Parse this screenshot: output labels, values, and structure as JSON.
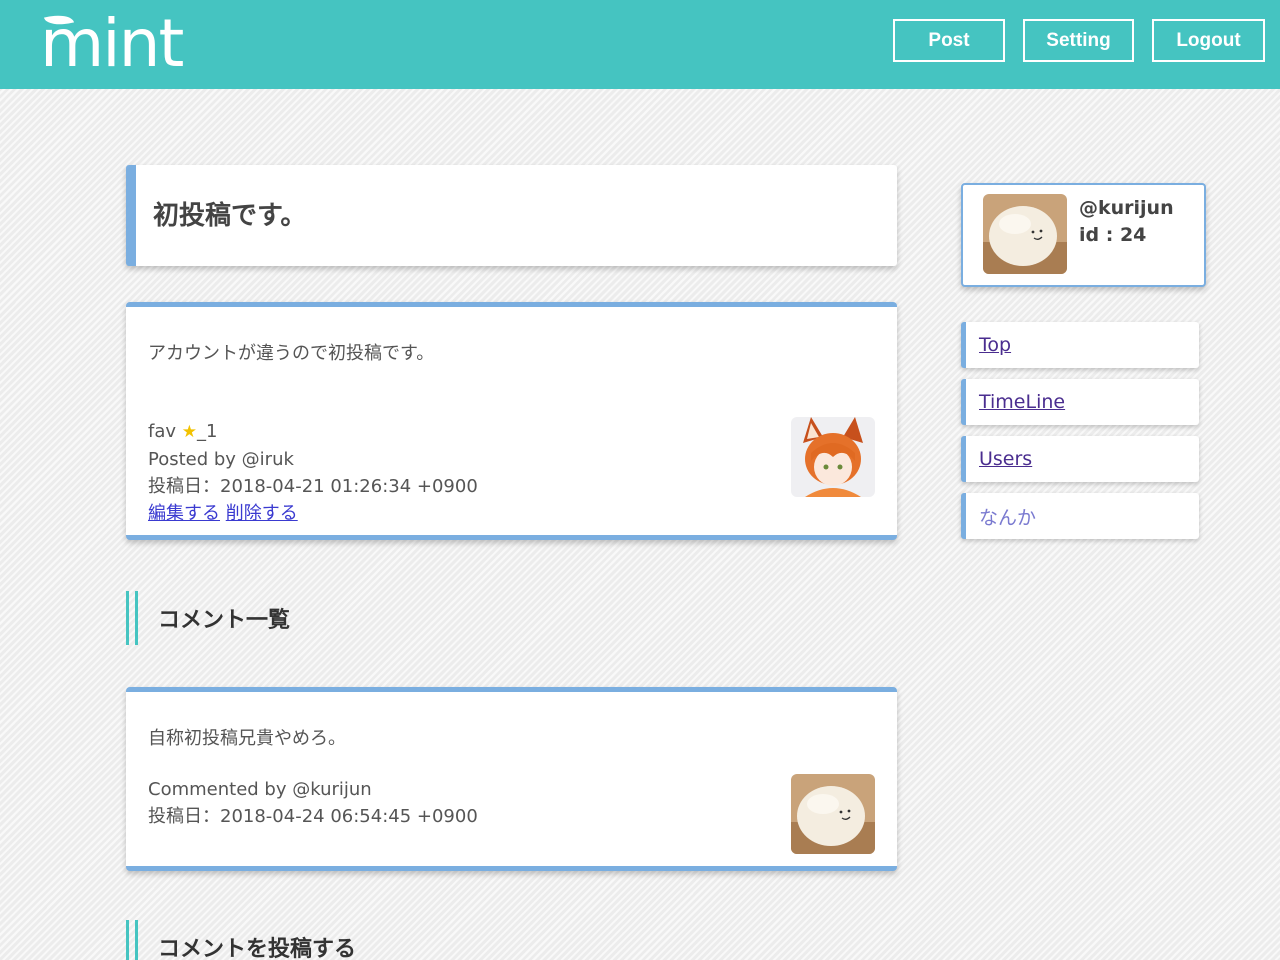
{
  "header": {
    "logo": "mint",
    "buttons": {
      "post": "Post",
      "setting": "Setting",
      "logout": "Logout"
    },
    "color": "#45c4c1"
  },
  "post": {
    "title": "初投稿です。",
    "body": "アカウントが違うので初投稿です。",
    "fav_label": "fav",
    "fav_count": "_1",
    "posted_by": "Posted by @iruk",
    "date": "投稿日：2018-04-21 01:26:34 +0900",
    "edit_link": "編集する",
    "delete_link": "削除する"
  },
  "comments_section": {
    "title": "コメント一覧"
  },
  "comments": [
    {
      "body": "自称初投稿兄貴やめろ。",
      "commented_by": "Commented by @kurijun",
      "date": "投稿日：2018-04-24 06:54:45 +0900"
    }
  ],
  "comment_form": {
    "title": "コメントを投稿する"
  },
  "profile": {
    "name": "@kurijun",
    "id": "id : 24"
  },
  "nav": {
    "items": [
      "Top",
      "TimeLine",
      "Users",
      "なんか"
    ]
  },
  "accent": "#7aaee0"
}
